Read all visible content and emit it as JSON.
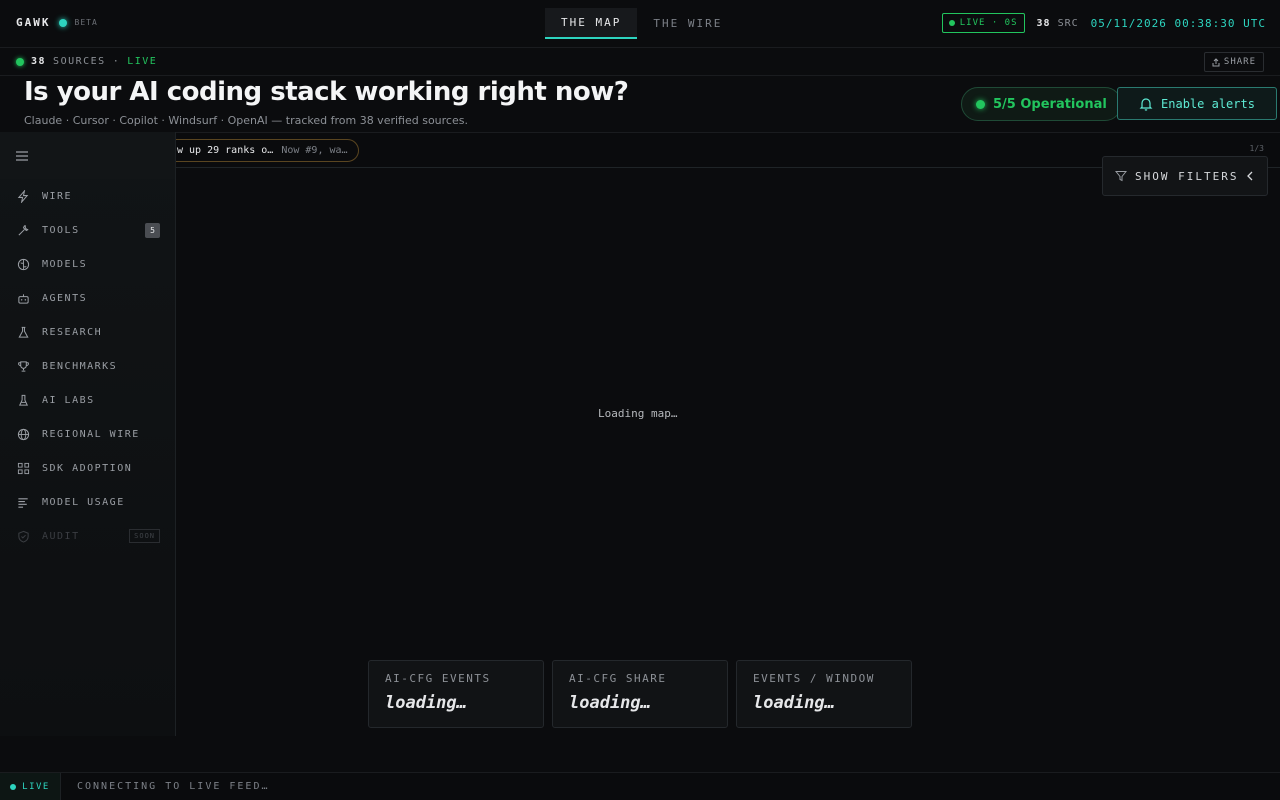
{
  "brand": {
    "name": "GAWK",
    "badge": "BETA"
  },
  "nav": {
    "tabs": [
      {
        "label": "THE MAP",
        "active": true
      },
      {
        "label": "THE WIRE",
        "active": false
      }
    ]
  },
  "status": {
    "live_pill": "LIVE · 0S",
    "src_count": "38",
    "src_label": "SRC",
    "clock": "05/11/2026 00:38:30 UTC"
  },
  "subbar": {
    "sources_count": "38",
    "sources_label": "SOURCES",
    "sep": "·",
    "live": "LIVE",
    "share": "SHARE"
  },
  "hero": {
    "title": "Is your AI coding stack working right now?",
    "subtitle": "Claude · Cursor · Copilot · Windsurf · OpenAI — tracked from 38 verified sources.",
    "operational": "5/5 Operational",
    "alerts_button": "Enable alerts"
  },
  "ticker": {
    "headline": "w up 29 ranks o…",
    "detail": "Now #9, wa…",
    "page": "1/3"
  },
  "sidebar": {
    "items": [
      {
        "label": "WIRE",
        "icon": "lightning-icon"
      },
      {
        "label": "TOOLS",
        "icon": "wrench-icon",
        "badge": "5"
      },
      {
        "label": "MODELS",
        "icon": "brain-icon"
      },
      {
        "label": "AGENTS",
        "icon": "robot-icon"
      },
      {
        "label": "RESEARCH",
        "icon": "flask-icon"
      },
      {
        "label": "BENCHMARKS",
        "icon": "trophy-icon"
      },
      {
        "label": "AI LABS",
        "icon": "beaker-icon"
      },
      {
        "label": "REGIONAL WIRE",
        "icon": "globe-icon"
      },
      {
        "label": "SDK ADOPTION",
        "icon": "grid-icon"
      },
      {
        "label": "MODEL USAGE",
        "icon": "bars-icon"
      },
      {
        "label": "AUDIT",
        "icon": "shield-check-icon",
        "soon": "SOON",
        "disabled": true
      }
    ]
  },
  "filters": {
    "label": "SHOW FILTERS"
  },
  "map": {
    "loading": "Loading map…"
  },
  "stats": [
    {
      "label": "AI-CFG EVENTS",
      "value": "loading…"
    },
    {
      "label": "AI-CFG SHARE",
      "value": "loading…"
    },
    {
      "label": "EVENTS / WINDOW",
      "value": "loading…"
    }
  ],
  "footer": {
    "live": "LIVE",
    "text": "CONNECTING TO LIVE FEED…"
  },
  "colors": {
    "accent": "#2dd4bf",
    "live_green": "#22c55e",
    "background": "#0b0c0e"
  }
}
